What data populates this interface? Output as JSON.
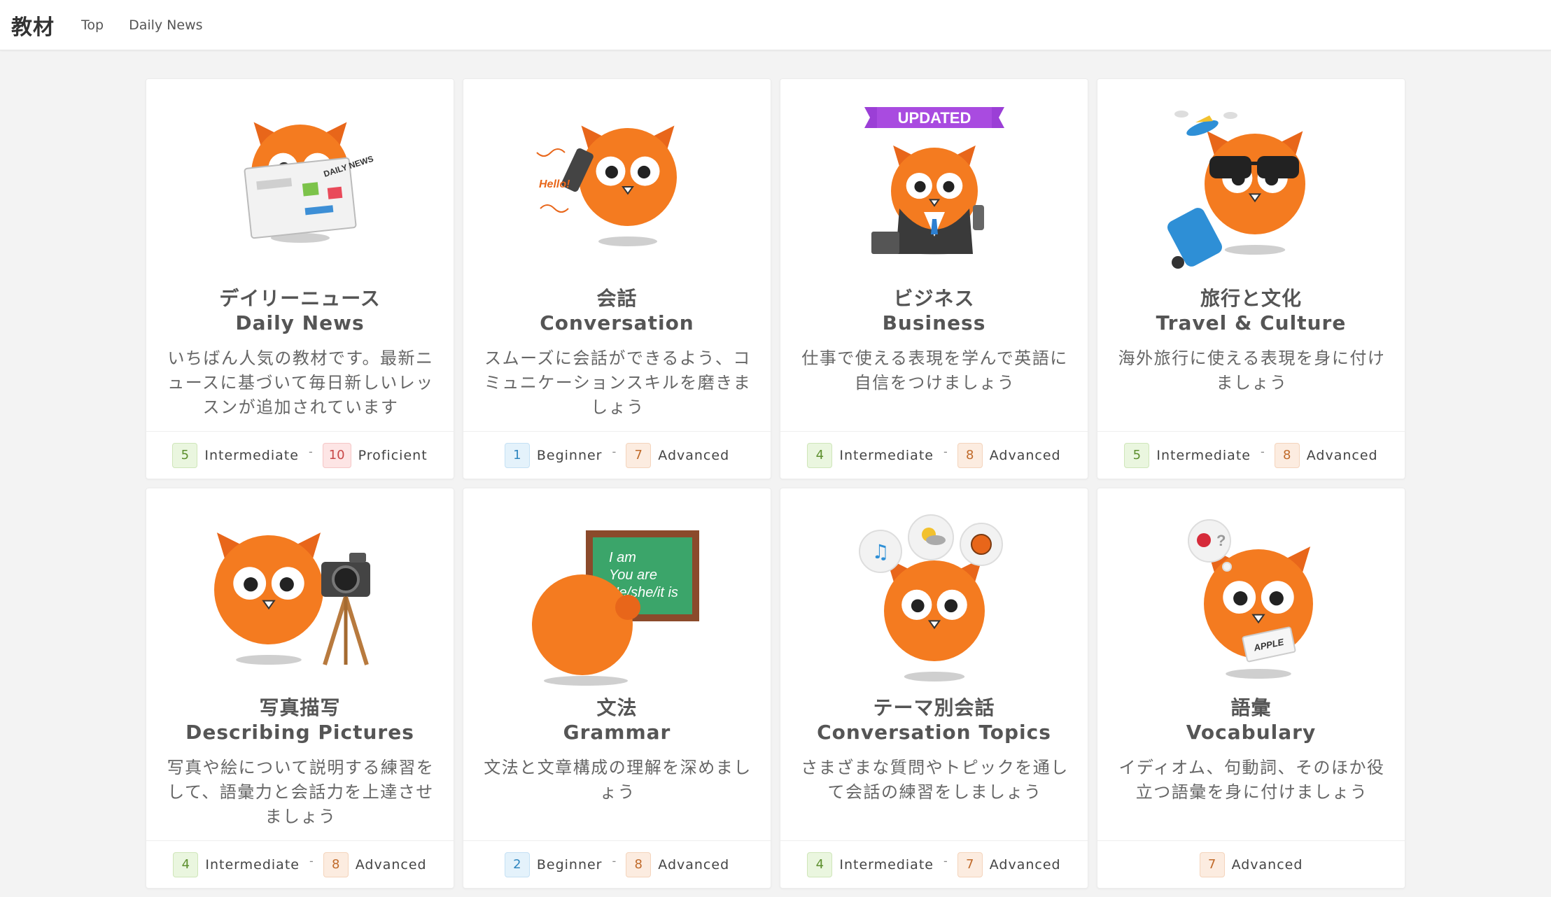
{
  "header": {
    "brand": "教材",
    "nav": [
      "Top",
      "Daily News"
    ]
  },
  "colors": {
    "owl_orange": "#f47b20",
    "intermediate": "#5c8f2d",
    "beginner": "#2f86bf",
    "advanced": "#c06a2a",
    "proficient": "#c84848",
    "updated_ribbon": "#9b3fd6"
  },
  "cards": [
    {
      "icon": "owl-reading-newspaper-icon",
      "title_jp": "デイリーニュース",
      "title_en": "Daily News",
      "desc": "いちばん人気の教材です。最新ニュースに基づいて毎日新しいレッスンが追加されています",
      "art_text": "DAILY NEWS",
      "levels": [
        {
          "num": "5",
          "label": "Intermediate"
        },
        {
          "num": "10",
          "label": "Proficient"
        }
      ]
    },
    {
      "icon": "owl-phone-call-icon",
      "title_jp": "会話",
      "title_en": "Conversation",
      "desc": "スムーズに会話ができるよう、コミュニケーションスキルを磨きましょう",
      "art_text": "Hello!",
      "levels": [
        {
          "num": "1",
          "label": "Beginner"
        },
        {
          "num": "7",
          "label": "Advanced"
        }
      ]
    },
    {
      "icon": "owl-business-suit-icon",
      "title_jp": "ビジネス",
      "title_en": "Business",
      "desc": "仕事で使える表現を学んで英語に自信をつけましょう",
      "badge": "UPDATED",
      "levels": [
        {
          "num": "4",
          "label": "Intermediate"
        },
        {
          "num": "8",
          "label": "Advanced"
        }
      ]
    },
    {
      "icon": "owl-travel-sunglasses-icon",
      "title_jp": "旅行と文化",
      "title_en": "Travel & Culture",
      "desc": "海外旅行に使える表現を身に付けましょう",
      "levels": [
        {
          "num": "5",
          "label": "Intermediate"
        },
        {
          "num": "8",
          "label": "Advanced"
        }
      ]
    },
    {
      "icon": "owl-camera-tripod-icon",
      "title_jp": "写真描写",
      "title_en": "Describing Pictures",
      "desc": "写真や絵について説明する練習をして、語彙力と会話力を上達させましょう",
      "levels": [
        {
          "num": "4",
          "label": "Intermediate"
        },
        {
          "num": "8",
          "label": "Advanced"
        }
      ]
    },
    {
      "icon": "owl-chalkboard-icon",
      "title_jp": "文法",
      "title_en": "Grammar",
      "desc": "文法と文章構成の理解を深めましょう",
      "art_lines": [
        "I am",
        "You are",
        "He/she/it is"
      ],
      "levels": [
        {
          "num": "2",
          "label": "Beginner"
        },
        {
          "num": "8",
          "label": "Advanced"
        }
      ]
    },
    {
      "icon": "owl-thought-bubbles-icon",
      "title_jp": "テーマ別会話",
      "title_en": "Conversation Topics",
      "desc": "さまざまな質問やトピックを通して会話の練習をしましょう",
      "levels": [
        {
          "num": "4",
          "label": "Intermediate"
        },
        {
          "num": "7",
          "label": "Advanced"
        }
      ]
    },
    {
      "icon": "owl-apple-card-icon",
      "title_jp": "語彙",
      "title_en": "Vocabulary",
      "desc": "イディオム、句動詞、そのほか役立つ語彙を身に付けましょう",
      "art_text": "APPLE",
      "levels": [
        {
          "num": "7",
          "label": "Advanced"
        }
      ]
    }
  ]
}
